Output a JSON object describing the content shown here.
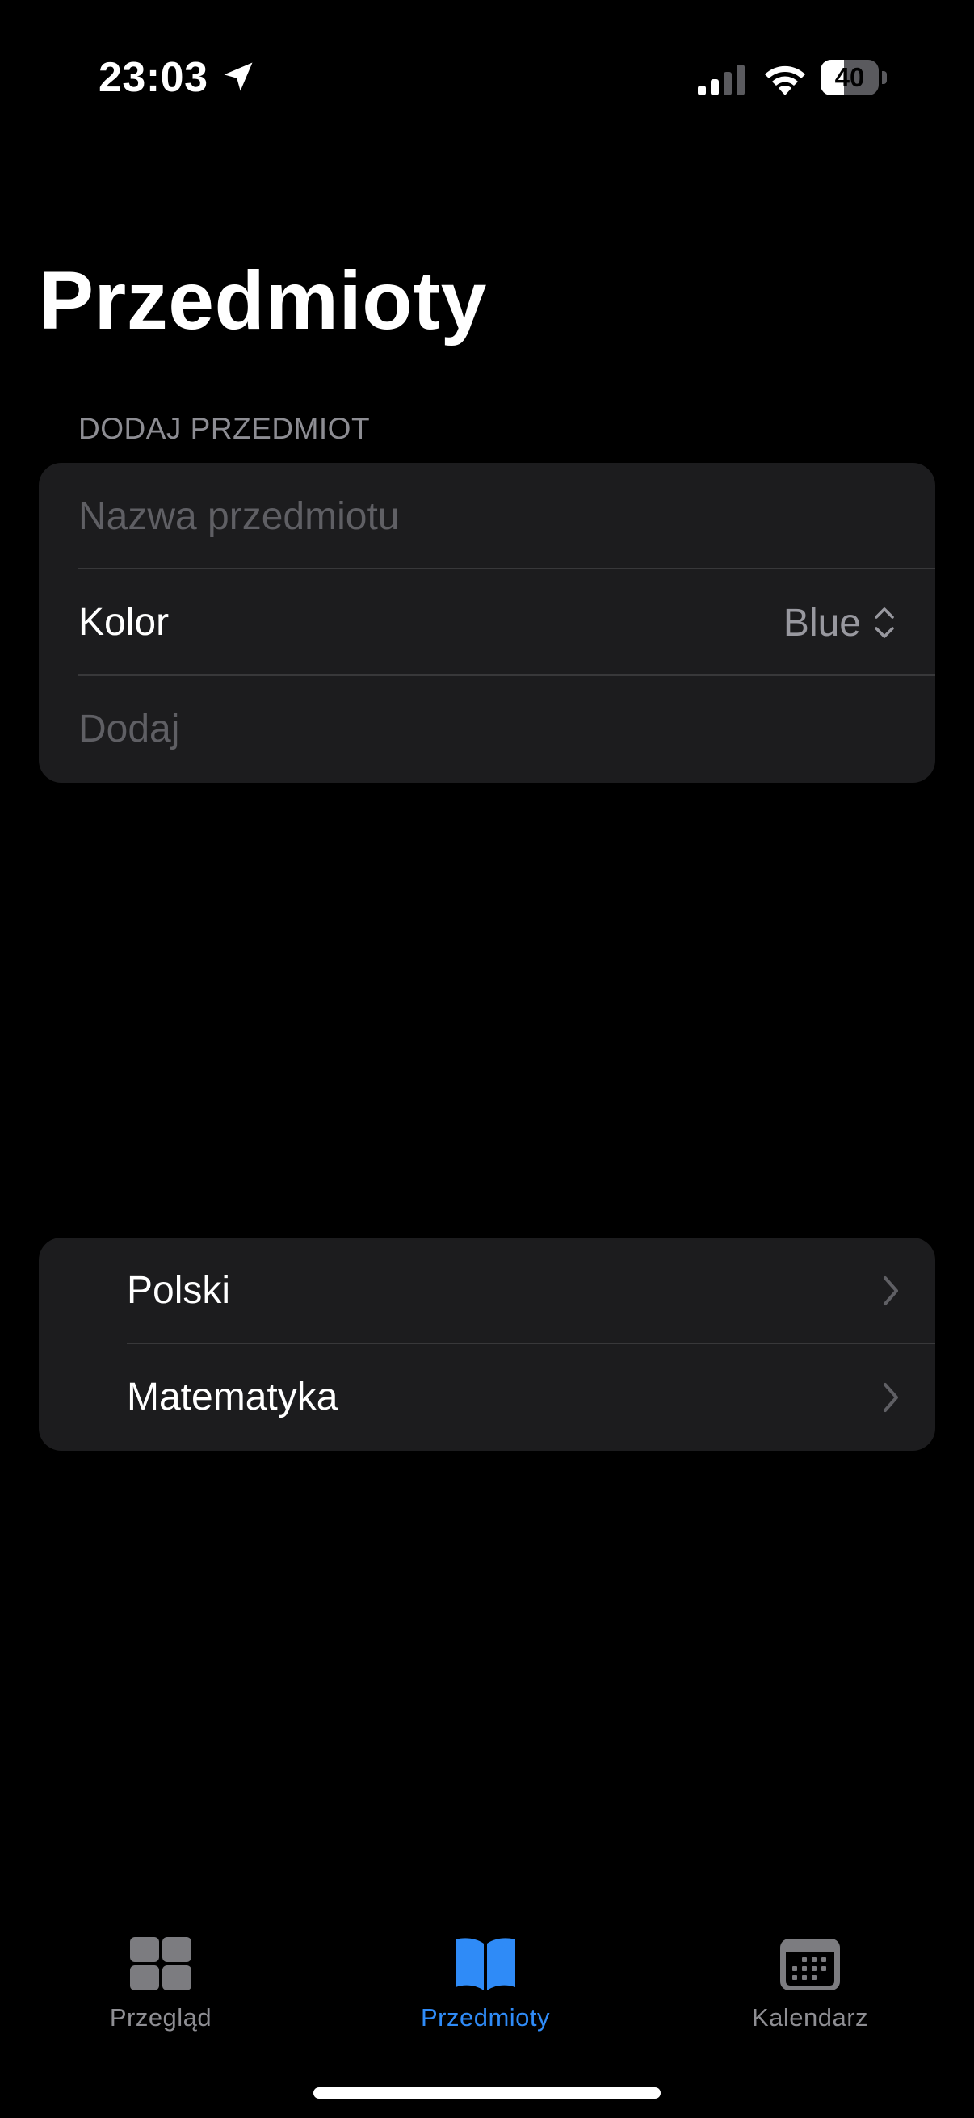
{
  "status_bar": {
    "time": "23:03",
    "battery_level": "40",
    "battery_percent": 40,
    "signal_bars_active": 2,
    "signal_bars_total": 4
  },
  "page": {
    "title": "Przedmioty"
  },
  "add_subject_section": {
    "header": "DODAJ PRZEDMIOT",
    "name_placeholder": "Nazwa przedmiotu",
    "name_value": "",
    "color_label": "Kolor",
    "color_value": "Blue",
    "add_button_label": "Dodaj"
  },
  "subjects": [
    {
      "label": "Polski"
    },
    {
      "label": "Matematyka"
    }
  ],
  "tab_bar": {
    "tabs": [
      {
        "label": "Przegląd",
        "icon": "grid-icon",
        "selected": false
      },
      {
        "label": "Przedmioty",
        "icon": "book-icon",
        "selected": true
      },
      {
        "label": "Kalendarz",
        "icon": "calendar-icon",
        "selected": false
      }
    ]
  },
  "colors": {
    "background": "#000000",
    "card": "#1c1c1e",
    "separator": "#38383a",
    "secondary_text": "#8d8d93",
    "placeholder_text": "#5f5f64",
    "accent": "#2f8bf7",
    "tab_inactive": "#8e8e93"
  }
}
